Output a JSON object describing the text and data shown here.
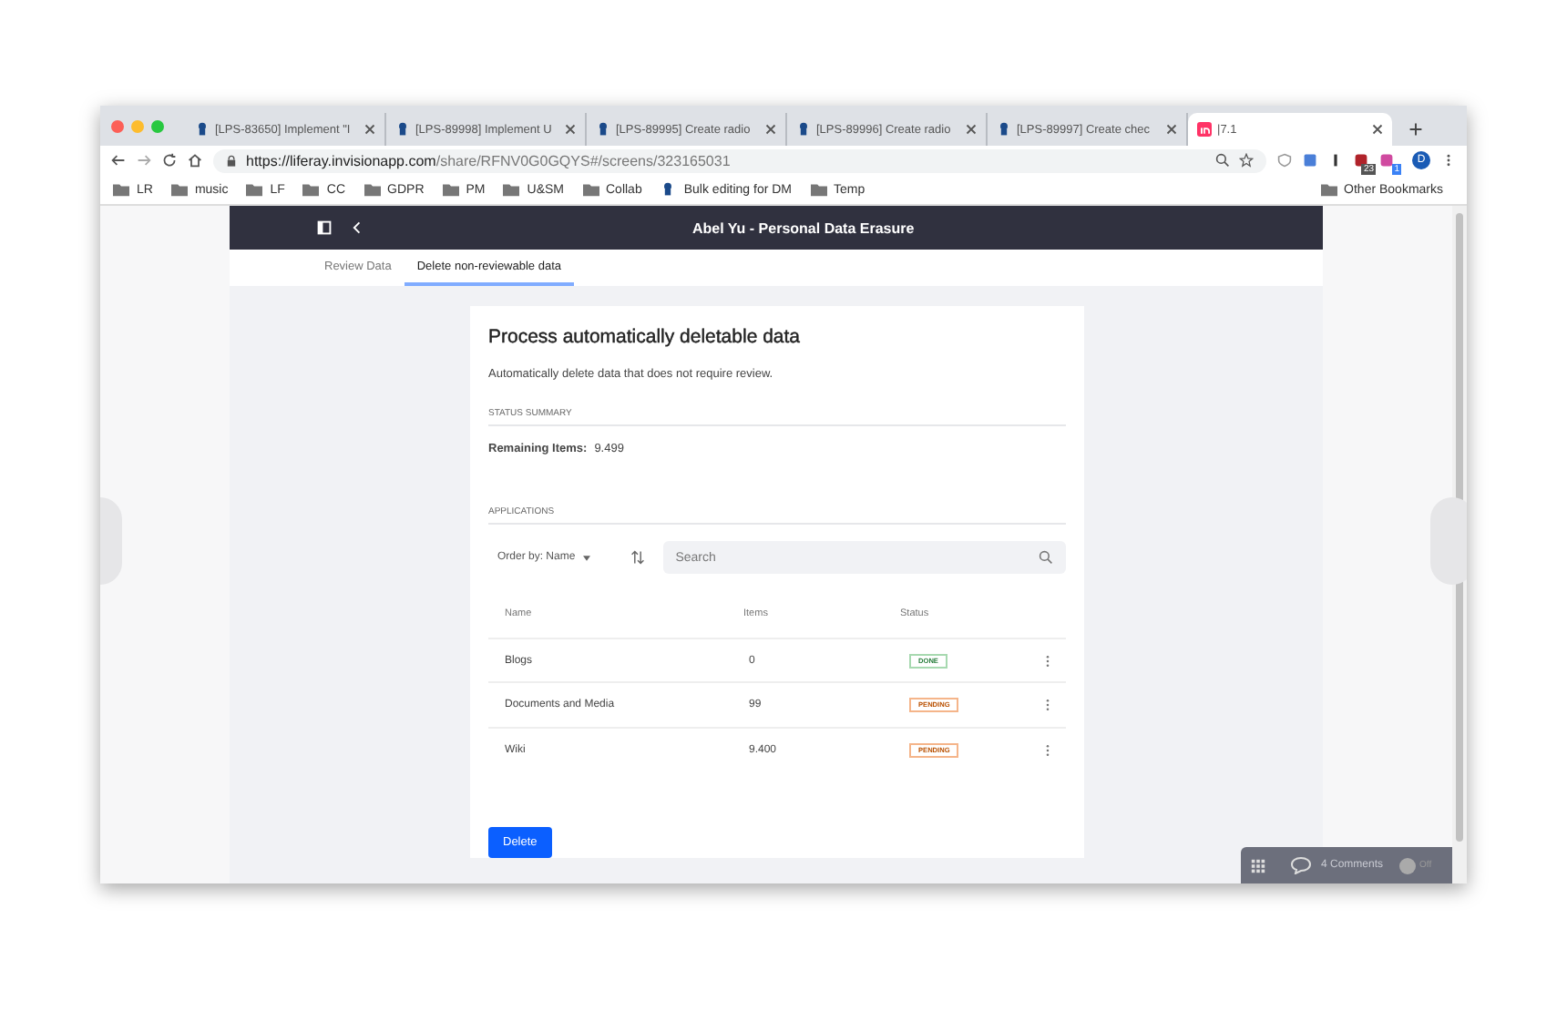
{
  "browser": {
    "tabs": [
      {
        "title": "[LPS-83650] Implement \"I",
        "kind": "liferay",
        "selected": false
      },
      {
        "title": "[LPS-89998] Implement U",
        "kind": "liferay",
        "selected": false
      },
      {
        "title": "[LPS-89995] Create radio",
        "kind": "liferay",
        "selected": false
      },
      {
        "title": "[LPS-89996] Create radio",
        "kind": "liferay",
        "selected": false
      },
      {
        "title": "[LPS-89997] Create chec",
        "kind": "liferay",
        "selected": false
      },
      {
        "title": "|7.1",
        "kind": "invision",
        "selected": true
      }
    ],
    "url_host": "https://liferay.invisionapp.com",
    "url_path": "/share/RFNV0G0GQYS#/screens/323165031",
    "extension_badges": [
      "23",
      "1"
    ],
    "profile_initial": "D",
    "bookmarks": [
      {
        "label": "LR",
        "kind": "folder"
      },
      {
        "label": "music",
        "kind": "folder"
      },
      {
        "label": "LF",
        "kind": "folder"
      },
      {
        "label": "CC",
        "kind": "folder"
      },
      {
        "label": "GDPR",
        "kind": "folder"
      },
      {
        "label": "PM",
        "kind": "folder"
      },
      {
        "label": "U&SM",
        "kind": "folder"
      },
      {
        "label": "Collab",
        "kind": "folder"
      },
      {
        "label": "Bulk editing for DM",
        "kind": "liferay"
      },
      {
        "label": "Temp",
        "kind": "folder"
      }
    ],
    "other_bookmarks": "Other Bookmarks"
  },
  "app": {
    "title": "Abel Yu - Personal Data Erasure",
    "nav_tabs": [
      {
        "label": "Review Data",
        "selected": false
      },
      {
        "label": "Delete non-reviewable data",
        "selected": true
      }
    ],
    "card": {
      "title": "Process automatically deletable data",
      "description": "Automatically delete data that does not require review.",
      "status_heading": "STATUS SUMMARY",
      "remaining_label": "Remaining Items:",
      "remaining_value": "9.499",
      "applications_heading": "APPLICATIONS",
      "order_by": "Order by: Name",
      "search": {
        "placeholder": "Search"
      },
      "table": {
        "columns": [
          "Name",
          "Items",
          "Status"
        ],
        "rows": [
          {
            "name": "Blogs",
            "items": "0",
            "status": "DONE",
            "kind": "done"
          },
          {
            "name": "Documents and Media",
            "items": "99",
            "status": "PENDING",
            "kind": "pending"
          },
          {
            "name": "Wiki",
            "items": "9.400",
            "status": "PENDING",
            "kind": "pending"
          }
        ]
      },
      "delete_button": "Delete"
    }
  },
  "comments": {
    "count": "4 Comments",
    "toggle_label": "Off",
    "on": false
  }
}
